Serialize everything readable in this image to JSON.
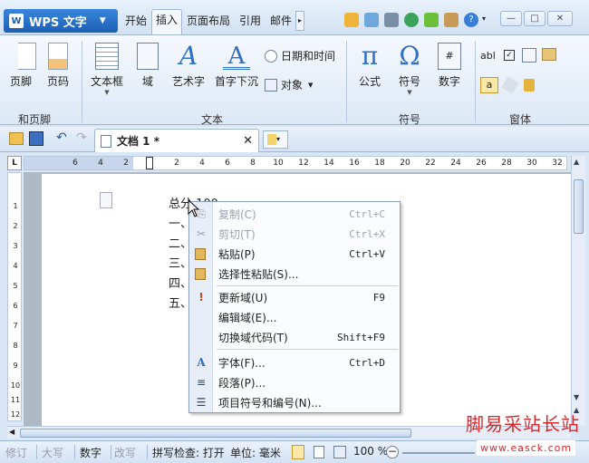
{
  "app": {
    "title": "WPS 文字"
  },
  "tabs": [
    "开始",
    "插入",
    "页面布局",
    "引用",
    "邮件"
  ],
  "active_tab": "插入",
  "ribbon": {
    "items": {
      "footer": "页脚",
      "page_number": "页码",
      "textbox": "文本框",
      "field": "域",
      "wordart": "艺术字",
      "dropcap": "首字下沉",
      "datetime": "日期和时间",
      "object": "对象",
      "formula": "公式",
      "symbol": "符号",
      "number": "数字"
    },
    "groups": {
      "header_footer": "和页脚",
      "text": "文本",
      "symbol": "符号",
      "form": "窗体"
    }
  },
  "document_tab": {
    "name": "文档 1 *"
  },
  "ruler": {
    "horizontal": [
      "6",
      "4",
      "2",
      "2",
      "4",
      "6",
      "8",
      "10",
      "12",
      "14",
      "16",
      "18",
      "20",
      "22",
      "24",
      "26",
      "28",
      "30",
      "32"
    ],
    "vertical": [
      "1",
      "2",
      "3",
      "4",
      "5",
      "6",
      "7",
      "8",
      "9",
      "10",
      "11",
      "12"
    ]
  },
  "document": {
    "lines": [
      "总分 100",
      "一、填",
      "二、判",
      "三、选",
      "四、简",
      "五、论"
    ]
  },
  "context_menu": {
    "items": [
      {
        "label": "复制(C)",
        "shortcut": "Ctrl+C",
        "disabled": true,
        "icon": "copy-icon"
      },
      {
        "label": "剪切(T)",
        "shortcut": "Ctrl+X",
        "disabled": true,
        "icon": "cut-icon"
      },
      {
        "label": "粘贴(P)",
        "shortcut": "Ctrl+V",
        "disabled": false,
        "icon": "paste-icon"
      },
      {
        "label": "选择性粘贴(S)...",
        "shortcut": "",
        "disabled": false,
        "icon": "paste-special-icon"
      },
      {
        "label": "更新域(U)",
        "shortcut": "F9",
        "disabled": false,
        "icon": "update-field-icon"
      },
      {
        "label": "编辑域(E)...",
        "shortcut": "",
        "disabled": false,
        "icon": ""
      },
      {
        "label": "切换域代码(T)",
        "shortcut": "Shift+F9",
        "disabled": false,
        "icon": ""
      },
      {
        "label": "字体(F)...",
        "shortcut": "Ctrl+D",
        "disabled": false,
        "icon": "font-icon"
      },
      {
        "label": "段落(P)...",
        "shortcut": "",
        "disabled": false,
        "icon": "paragraph-icon"
      },
      {
        "label": "项目符号和编号(N)...",
        "shortcut": "",
        "disabled": false,
        "icon": "bullets-icon"
      }
    ]
  },
  "status_bar": {
    "revision": "修订",
    "caps": "大写",
    "numlock": "数字",
    "overwrite": "改写",
    "spellcheck": "拼写检查: 打开",
    "unit": "单位: 毫米",
    "zoom": "100 %"
  },
  "watermark": {
    "main": "脚易采站长站",
    "url": "www.easck.com"
  },
  "colors": {
    "accent": "#1b5fb4",
    "ribbon_bg": "#dce8f6",
    "watermark": "#d6282b"
  }
}
